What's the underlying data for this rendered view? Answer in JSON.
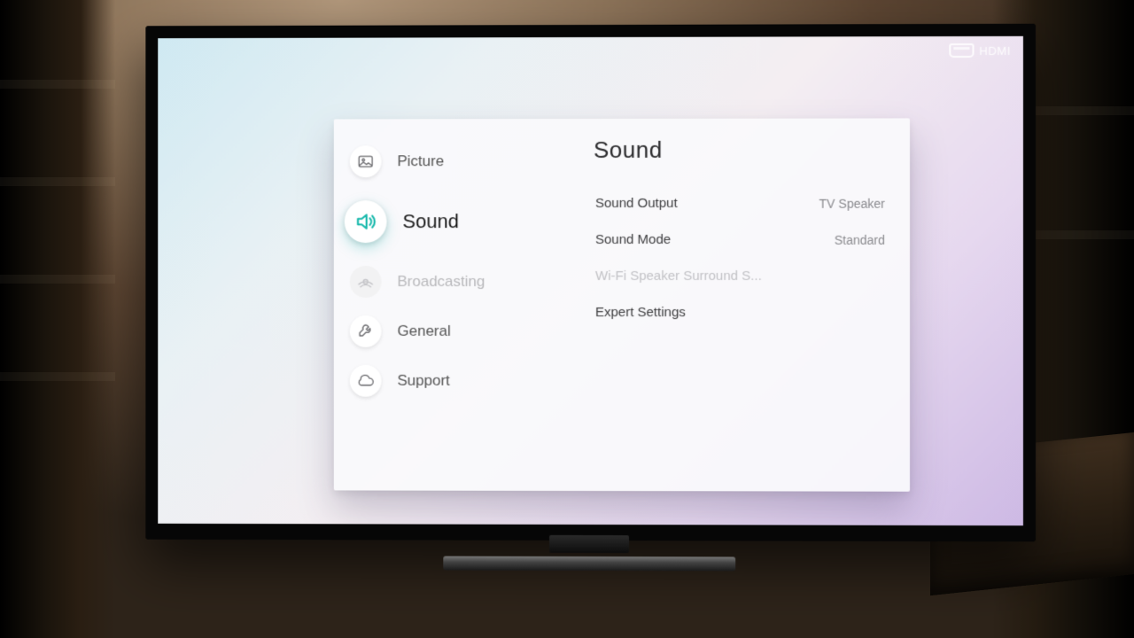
{
  "input_badge": {
    "label": "HDMI"
  },
  "sidebar": {
    "items": [
      {
        "label": "Picture",
        "icon": "picture-icon",
        "active": false,
        "disabled": false
      },
      {
        "label": "Sound",
        "icon": "sound-icon",
        "active": true,
        "disabled": false
      },
      {
        "label": "Broadcasting",
        "icon": "broadcast-icon",
        "active": false,
        "disabled": true
      },
      {
        "label": "General",
        "icon": "general-icon",
        "active": false,
        "disabled": false
      },
      {
        "label": "Support",
        "icon": "support-icon",
        "active": false,
        "disabled": false
      }
    ]
  },
  "content": {
    "title": "Sound",
    "rows": [
      {
        "label": "Sound Output",
        "value": "TV Speaker",
        "disabled": false
      },
      {
        "label": "Sound Mode",
        "value": "Standard",
        "disabled": false
      },
      {
        "label": "Wi-Fi Speaker Surround S...",
        "value": "",
        "disabled": true
      },
      {
        "label": "Expert Settings",
        "value": "",
        "disabled": false
      }
    ]
  }
}
